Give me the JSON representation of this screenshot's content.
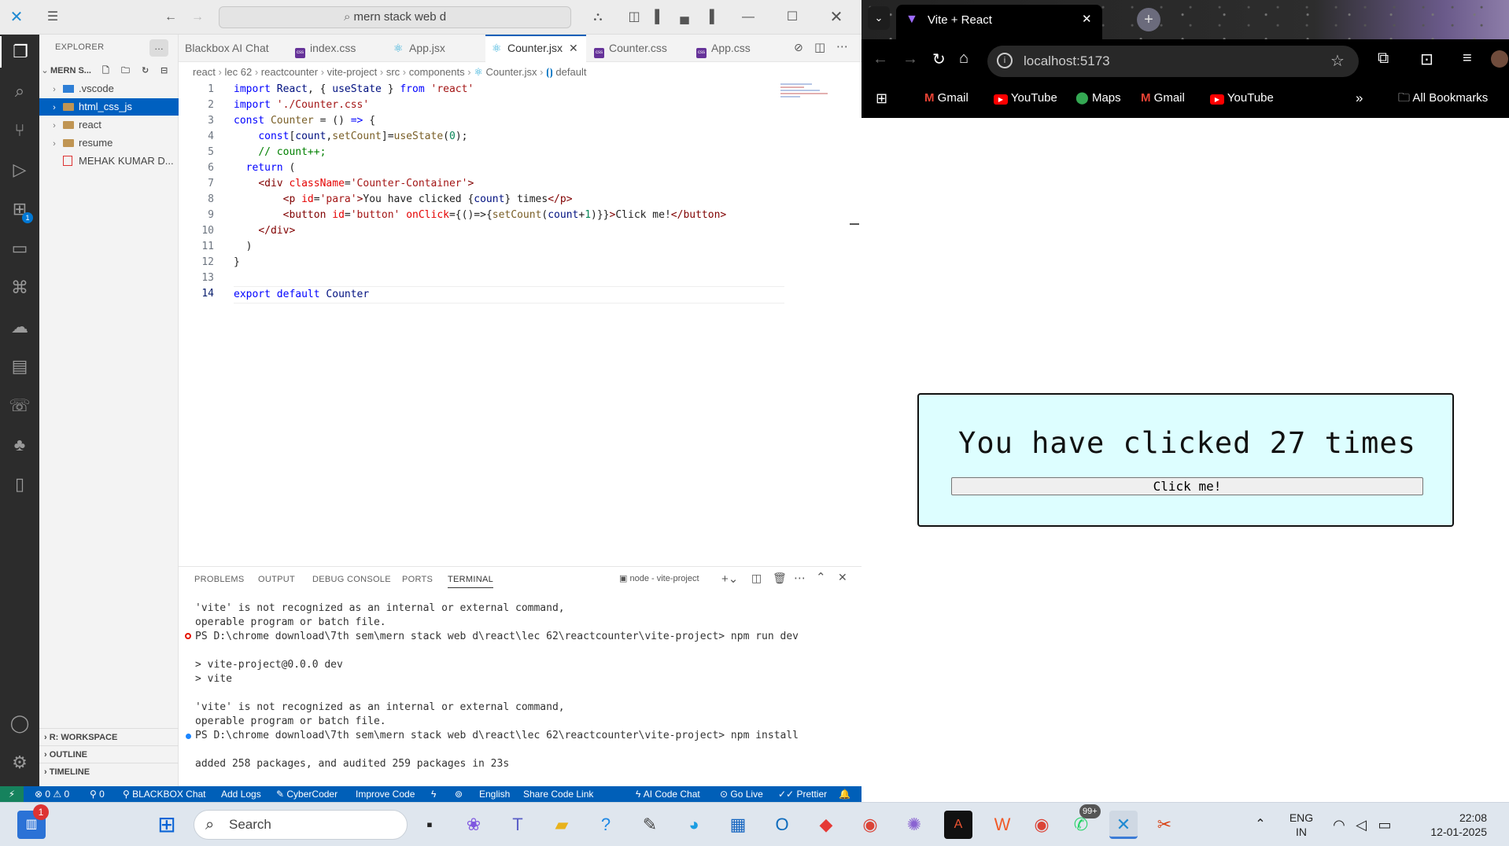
{
  "vscode": {
    "command_center": "mern stack web d",
    "explorer_title": "EXPLORER",
    "root_folder": "MERN S...",
    "tree": [
      {
        "label": ".vscode",
        "type": "folder"
      },
      {
        "label": "html_css_js",
        "type": "folder"
      },
      {
        "label": "react",
        "type": "folder"
      },
      {
        "label": "resume",
        "type": "folder"
      },
      {
        "label": "MEHAK KUMAR D...",
        "type": "pdf"
      }
    ],
    "sidebar_sections": [
      "R: WORKSPACE",
      "OUTLINE",
      "TIMELINE"
    ],
    "tabs": [
      {
        "label": "Blackbox AI Chat"
      },
      {
        "label": "index.css"
      },
      {
        "label": "App.jsx"
      },
      {
        "label": "Counter.jsx"
      },
      {
        "label": "Counter.css"
      },
      {
        "label": "App.css"
      }
    ],
    "breadcrumb": [
      "react",
      "lec 62",
      "reactcounter",
      "vite-project",
      "src",
      "components",
      "Counter.jsx",
      "default"
    ],
    "line_numbers": [
      "1",
      "2",
      "3",
      "4",
      "5",
      "6",
      "7",
      "8",
      "9",
      "10",
      "11",
      "12",
      "13",
      "14"
    ],
    "panel_tabs": [
      "PROBLEMS",
      "OUTPUT",
      "DEBUG CONSOLE",
      "PORTS",
      "TERMINAL"
    ],
    "terminal_name": "node - vite-project",
    "terminal_lines": [
      "'vite' is not recognized as an internal or external command,",
      "operable program or batch file.",
      "PS D:\\chrome download\\7th sem\\mern stack web d\\react\\lec 62\\reactcounter\\vite-project> npm run dev",
      "",
      "> vite-project@0.0.0 dev",
      "> vite",
      "",
      "'vite' is not recognized as an internal or external command,",
      "operable program or batch file.",
      "PS D:\\chrome download\\7th sem\\mern stack web d\\react\\lec 62\\reactcounter\\vite-project> npm install",
      "",
      "added 258 packages, and audited 259 packages in 23s"
    ],
    "status": {
      "errors": "0",
      "warnings": "0",
      "ports": "0",
      "items": [
        "BLACKBOX Chat",
        "Add Logs",
        "CyberCoder",
        "Improve Code",
        "English",
        "Share Code Link",
        "AI Code Chat",
        "Go Live",
        "Prettier"
      ]
    },
    "extensions_badge": "1"
  },
  "browser": {
    "tab_title": "Vite + React",
    "url": "localhost:5173",
    "bookmarks": [
      "Gmail",
      "YouTube",
      "Maps",
      "Gmail",
      "YouTube"
    ],
    "all_bookmarks": "All Bookmarks",
    "page": {
      "para": "You have clicked 27 times",
      "button": "Click me!"
    }
  },
  "taskbar": {
    "search_placeholder": "Search",
    "notification_badge": "1",
    "whatsapp_badge": "99+",
    "lang": "ENG",
    "region": "IN",
    "time": "22:08",
    "date": "12-01-2025"
  },
  "colors": {
    "vscode_accent": "#005fb8",
    "selection": "#0060c0",
    "counter_bg": "#ddfeff"
  }
}
